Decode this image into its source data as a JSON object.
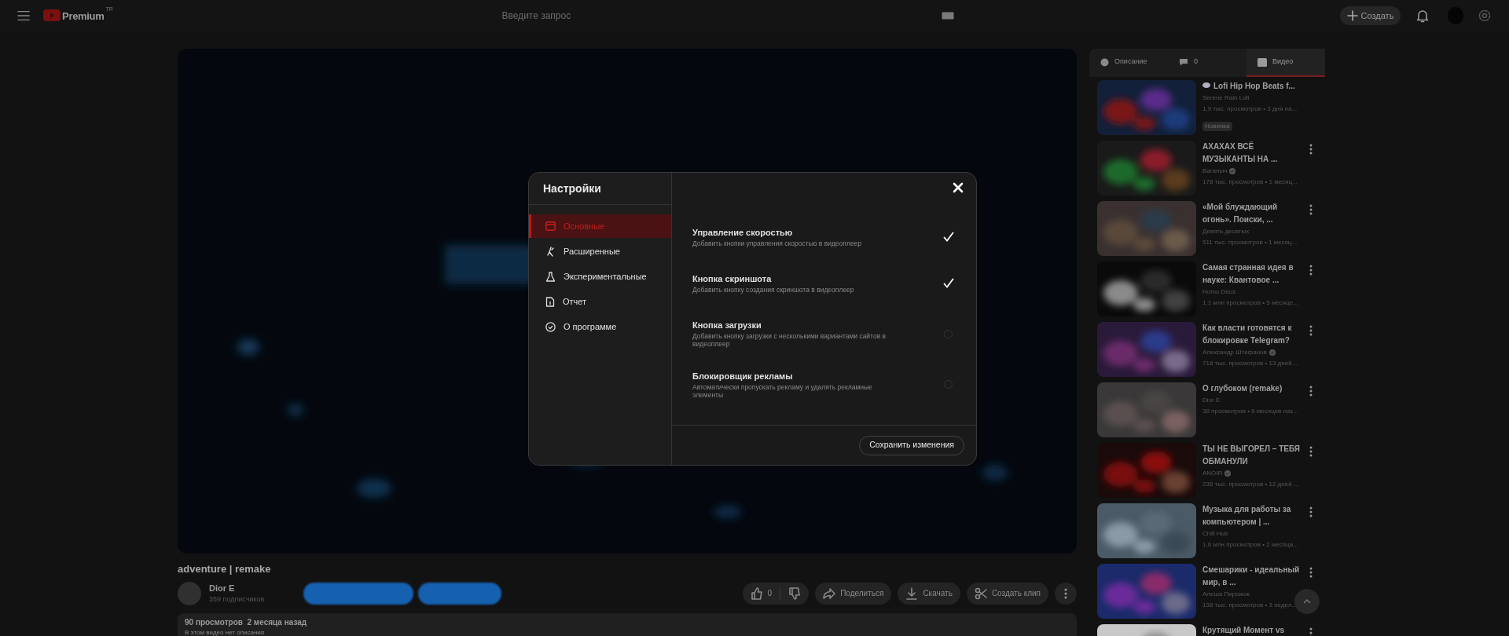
{
  "topbar": {
    "logo_text": "Premium",
    "region": "TR",
    "search_placeholder": "Введите запрос",
    "create_label": "Создать"
  },
  "video": {
    "title": "adventure | remake",
    "channel": "Dior E",
    "subscribers": "359 подписчиков",
    "likes": "0",
    "actions": [
      {
        "kind": "share",
        "label": "Поделиться"
      },
      {
        "kind": "download",
        "label": "Скачать"
      },
      {
        "kind": "clip",
        "label": "Создать клип"
      }
    ],
    "description": {
      "stats": "90 просмотров  2 месяца назад",
      "text": "В этом видео нет описания"
    }
  },
  "sidebar": {
    "tabs": [
      {
        "kind": "description",
        "label": "Описание",
        "selected": false
      },
      {
        "kind": "comments",
        "label": "0",
        "selected": false
      },
      {
        "kind": "videos",
        "label": "Видео",
        "selected": true
      }
    ],
    "videos": [
      {
        "title": "Lofi Hip Hop Beats f...",
        "channel": "Serene Rain Lofi",
        "verified": false,
        "meta": "1,9 тыс. просмотров • 3 дня на...",
        "badge": "Новинка",
        "live_icon": true
      },
      {
        "title": "АХАХАХ ВСЁ МУЗЫКАНТЫ НА ...",
        "channel": "Ваганыч",
        "verified": true,
        "meta": "178 тыс. просмотров • 1 месяц..."
      },
      {
        "title": "«Мой блуждающий огонь». Поиски, ...",
        "channel": "Девять десятых",
        "verified": false,
        "meta": "511 тыс. просмотров • 1 месяц..."
      },
      {
        "title": "Самая странная идея в науке: Квантовое ...",
        "channel": "Homo Deus",
        "verified": false,
        "meta": "1,1 млн просмотров • 5 месяце..."
      },
      {
        "title": "Как власти готовятся к блокировке Telegram?",
        "channel": "Александр Штефанов",
        "verified": true,
        "meta": "718 тыс. просмотров • 13 дней ..."
      },
      {
        "title": "О глубоком (remake)",
        "channel": "Dior E",
        "verified": false,
        "meta": "38 просмотров • 6 месяцев наз..."
      },
      {
        "title": "ТЫ НЕ ВЫГОРЕЛ – ТЕБЯ ОБМАНУЛИ",
        "channel": "ANOIR",
        "verified": true,
        "meta": "236 тыс. просмотров • 12 дней ..."
      },
      {
        "title": "Музыка для работы за компьютером | ...",
        "channel": "Chill Hub",
        "verified": false,
        "meta": "1,6 млн просмотров • 2 месяца..."
      },
      {
        "title": "Смешарики - идеальный мир, в ...",
        "channel": "Алеша Пирожок",
        "verified": false,
        "meta": "138 тыс. просмотров • 3 недел..."
      },
      {
        "title": "Крутящий Момент vs"
      }
    ]
  },
  "settings": {
    "title": "Настройки",
    "nav": [
      {
        "kind": "general",
        "label": "Основные",
        "selected": true
      },
      {
        "kind": "advanced",
        "label": "Расширенные",
        "selected": false
      },
      {
        "kind": "experimental",
        "label": "Экспериментальные",
        "selected": false
      },
      {
        "kind": "report",
        "label": "Отчет",
        "selected": false
      },
      {
        "kind": "about",
        "label": "О программе",
        "selected": false
      }
    ],
    "options": [
      {
        "title": "Управление скоростью",
        "description": "Добавить кнопки управления скоростью в видеоплеер",
        "checked": true
      },
      {
        "title": "Кнопка скриншота",
        "description": "Добавить кнопку создания скриншота в видеоплеер",
        "checked": true
      },
      {
        "title": "Кнопка загрузки",
        "description": "Добавить кнопку загрузки с несколькими вариантами сайтов в видеоплеер",
        "checked": false
      },
      {
        "title": "Блокировщик рекламы",
        "description": "Автоматически пропускать рекламу и удалять рекламные элементы",
        "checked": false
      }
    ],
    "save_label": "Сохранить изменения"
  }
}
